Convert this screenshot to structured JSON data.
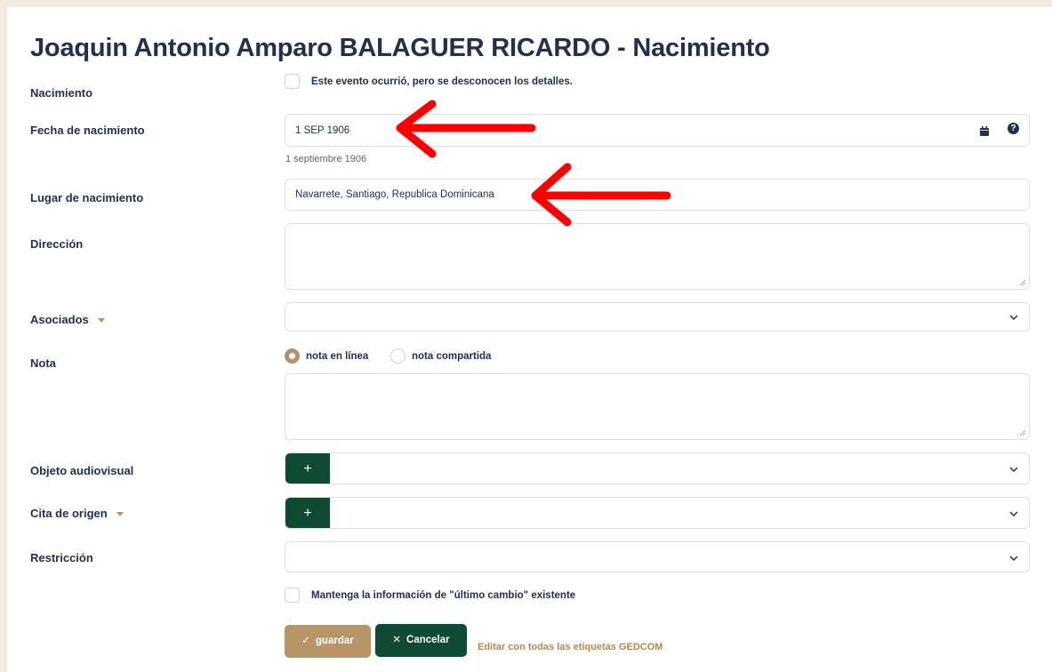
{
  "page": {
    "title": "Joaquin Antonio Amparo BALAGUER RICARDO - Nacimiento"
  },
  "event": {
    "label": "Nacimiento",
    "unknown_details_checkbox_label": "Este evento ocurrió, pero se desconocen los detalles.",
    "unknown_details_checked": false
  },
  "date": {
    "label": "Fecha de nacimiento",
    "value": "1 SEP 1906",
    "hint": "1 septiembre 1906",
    "calendar_icon": "calendar-icon",
    "help_icon": "help-icon",
    "help_glyph": "?"
  },
  "place": {
    "label": "Lugar de nacimiento",
    "value": "Navarrete, Santiago, Republica Dominicana"
  },
  "address": {
    "label": "Dirección",
    "value": ""
  },
  "associates": {
    "label": "Asociados",
    "value": ""
  },
  "note": {
    "label": "Nota",
    "options": [
      "nota en línea",
      "nota compartida"
    ],
    "selected": "nota en línea",
    "value": ""
  },
  "media": {
    "label": "Objeto audiovisual",
    "add_glyph": "+"
  },
  "source": {
    "label": "Cita de origen",
    "add_glyph": "+"
  },
  "restriction": {
    "label": "Restricción",
    "value": ""
  },
  "keep_last_change": {
    "label": "Mantenga la información de \"último cambio\" existente",
    "checked": false
  },
  "actions": {
    "save_icon": "✓",
    "save_label": "guardar",
    "cancel_icon": "✕",
    "cancel_label": "Cancelar",
    "gedcom_link": "Editar con todas las etiquetas GEDCOM"
  },
  "colors": {
    "background": "#f3ebe0",
    "text": "#22304e",
    "accent_brown": "#b89566",
    "dark_green": "#0f4a33",
    "annotation_arrow": "#ff0000"
  }
}
